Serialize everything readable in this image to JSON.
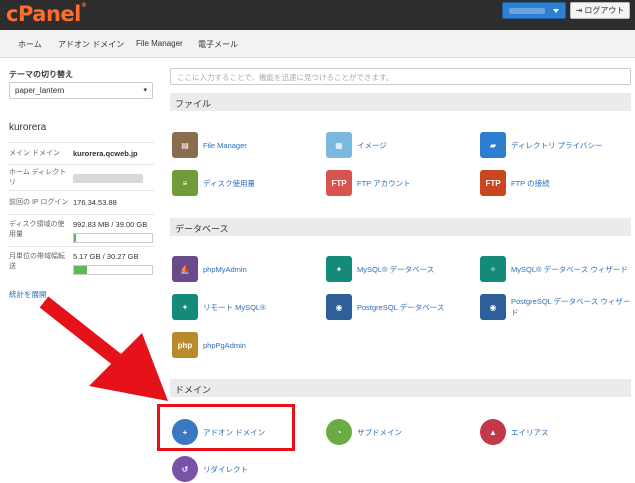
{
  "header": {
    "logo": "cPanel",
    "logo_mark": "®",
    "logout_label": "ログアウト"
  },
  "nav": {
    "items": [
      "ホーム",
      "アドオン ドメイン",
      "File Manager",
      "電子メール"
    ]
  },
  "sidebar": {
    "theme_label": "テーマの切り替え",
    "theme_value": "paper_lantern",
    "username": "kurorera",
    "rows": [
      {
        "key": "メイン ドメイン",
        "value": "kurorera.qcweb.jp"
      },
      {
        "key": "ホーム ディレクトリ",
        "value": ""
      },
      {
        "key": "前回の IP ログイン",
        "value": "176.34.53.88"
      },
      {
        "key": "ディスク領域の使用量",
        "value": "992.83 MB / 39.00 GB"
      },
      {
        "key": "月単位の帯域幅転送",
        "value": "5.17 GB / 30.27 GB"
      }
    ],
    "disk_usage_fraction": 0.025,
    "bandwidth_fraction": 0.17,
    "stats_link": "統計を展開"
  },
  "search": {
    "placeholder": "ここに入力することで、機能を迅速に見つけることができます。"
  },
  "sections": {
    "files": {
      "title": "ファイル",
      "items": [
        "File Manager",
        "イメージ",
        "ディレクトリ プライバシー",
        "ディスク使用量",
        "FTP アカウント",
        "FTP の接続"
      ]
    },
    "databases": {
      "title": "データベース",
      "items": [
        "phpMyAdmin",
        "MySQL® データベース",
        "MySQL® データベース ウィザード",
        "リモート MySQL®",
        "PostgreSQL データベース",
        "PostgreSQL データベース ウィザード",
        "phpPgAdmin"
      ]
    },
    "domains": {
      "title": "ドメイン",
      "items": [
        "アドオン ドメイン",
        "サブドメイン",
        "エイリアス",
        "リダイレクト"
      ]
    }
  },
  "colors": {
    "highlight": "#e5121a",
    "arrow": "#e5121a",
    "brand": "#ff6c2c",
    "link": "#2a6ebb"
  }
}
